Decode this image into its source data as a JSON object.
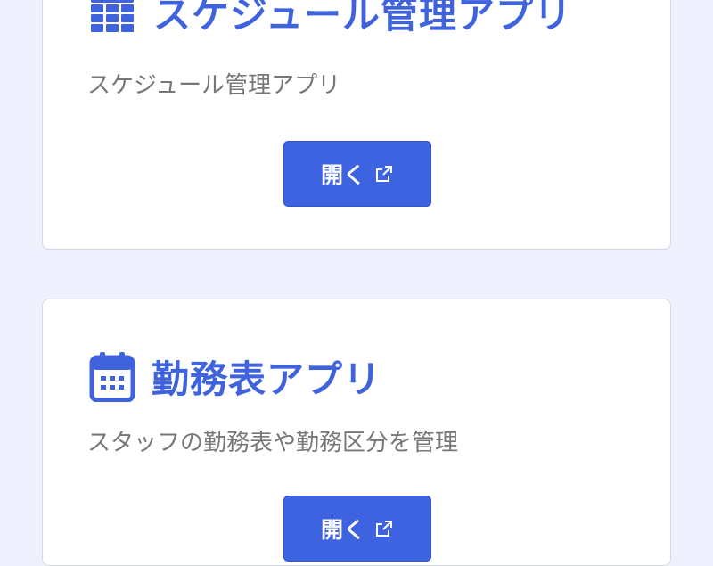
{
  "cards": [
    {
      "icon": "table-grid-icon",
      "title": "スケジュール管理アプリ",
      "description": "スケジュール管理アプリ",
      "button_label": "開く",
      "button_icon": "external-link-icon"
    },
    {
      "icon": "calendar-icon",
      "title": "勤務表アプリ",
      "description": "スタッフの勤務表や勤務区分を管理",
      "button_label": "開く",
      "button_icon": "external-link-icon"
    }
  ],
  "colors": {
    "page_background": "#eef1fd",
    "accent": "#3f63dc",
    "button": "#3d63e0",
    "description_text": "#777777",
    "card_border": "#d5d8e0"
  }
}
